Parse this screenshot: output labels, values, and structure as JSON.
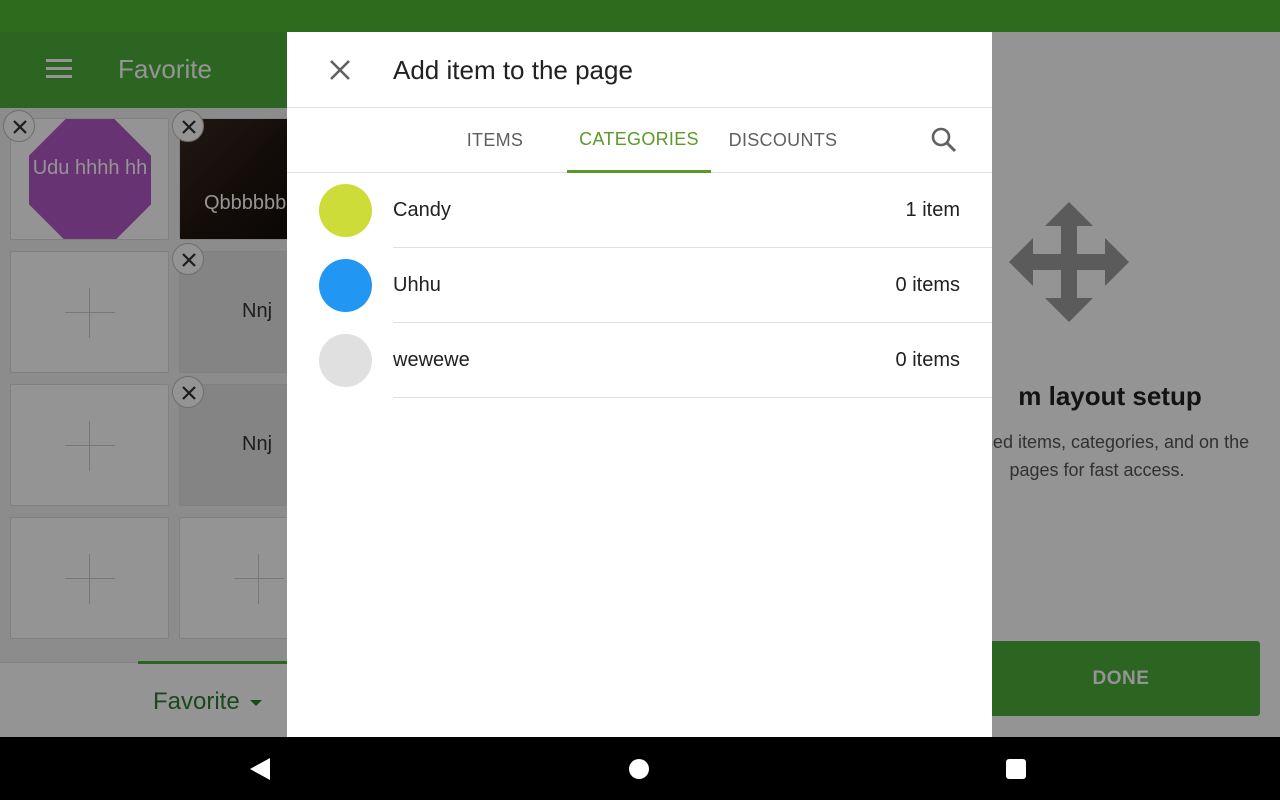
{
  "toolbar": {
    "title": "Favorite"
  },
  "grid": {
    "tiles": [
      {
        "label": "Udu hhhh hh"
      },
      {
        "label": "Qbbbbbbbbbbjbbh"
      },
      {
        "label": "Nnj"
      },
      {
        "label": "Nnj"
      }
    ]
  },
  "bottom_tabs": {
    "current_page": "Favorite"
  },
  "right_panel": {
    "title": "m layout setup",
    "description": "ost used items, categories, and on the pages for fast access.",
    "done_label": "DONE"
  },
  "dialog": {
    "title": "Add item to the page",
    "tabs": [
      {
        "label": "ITEMS"
      },
      {
        "label": "CATEGORIES"
      },
      {
        "label": "DISCOUNTS"
      }
    ],
    "active_tab": "CATEGORIES",
    "categories": [
      {
        "name": "Candy",
        "count": "1 item",
        "color": "#cddc39"
      },
      {
        "name": "Uhhu",
        "count": "0 items",
        "color": "#2196f3"
      },
      {
        "name": "wewewe",
        "count": "0 items",
        "color": "#e0e0e0"
      }
    ]
  },
  "colors": {
    "status_bar": "#2f6b1d",
    "toolbar": "#4caf3a",
    "accent": "#5b9a2a",
    "done_button": "#4caf3a"
  },
  "icons": {
    "toolbar": "menu-icon",
    "dialog_close": "close-icon",
    "dialog_search": "search-icon",
    "panel": "move-icon",
    "nav": [
      "back-icon",
      "home-icon",
      "recents-icon"
    ]
  }
}
